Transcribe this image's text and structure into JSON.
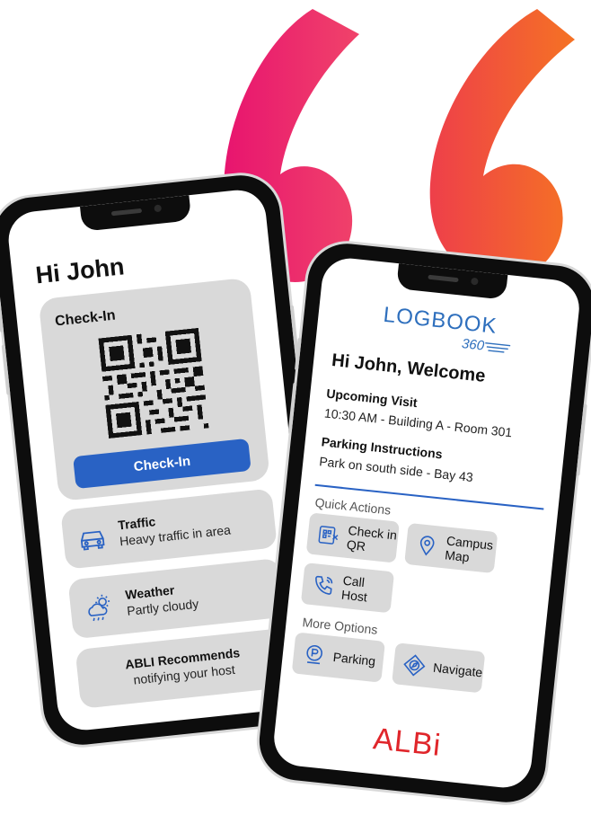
{
  "left_phone": {
    "greeting": "Hi John",
    "checkin": {
      "title": "Check-In",
      "button_label": "Check-In"
    },
    "traffic": {
      "title": "Traffic",
      "subtitle": "Heavy traffic in area"
    },
    "weather": {
      "title": "Weather",
      "subtitle": "Partly cloudy"
    },
    "recommend": {
      "title": "ABLI Recommends",
      "subtitle": "notifying your host"
    }
  },
  "right_phone": {
    "logo_text": "LOGBOOK",
    "logo_sub": "360",
    "welcome": "Hi John, Welcome",
    "upcoming": {
      "heading": "Upcoming Visit",
      "detail": "10:30 AM - Building A - Room 301"
    },
    "parking": {
      "heading": "Parking Instructions",
      "detail": "Park on south side - Bay 43"
    },
    "quick_actions": {
      "heading": "Quick Actions",
      "items": [
        {
          "label_line1": "Check in",
          "label_line2": "QR"
        },
        {
          "label_line1": "Campus",
          "label_line2": "Map"
        },
        {
          "label_line1": "Call",
          "label_line2": "Host"
        }
      ]
    },
    "more_options": {
      "heading": "More Options",
      "items": [
        {
          "label": "Parking"
        },
        {
          "label": "Navigate"
        }
      ]
    },
    "brand": "ALBi"
  },
  "colors": {
    "accent_blue": "#2962c4",
    "quote_left": "#ec1c6b",
    "quote_right": "#f36a21",
    "card_gray": "#d9d9d9",
    "brand_red": "#e0262b"
  },
  "icons": [
    "car-icon",
    "weather-icon",
    "qr-icon",
    "map-pin-icon",
    "phone-icon",
    "parking-icon",
    "compass-icon"
  ]
}
